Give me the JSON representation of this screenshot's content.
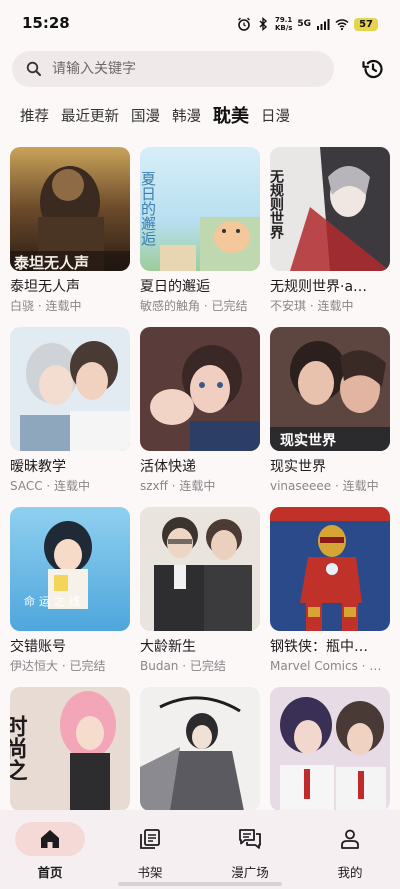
{
  "status_bar": {
    "time": "15:28",
    "net_speed_value": "79.1",
    "net_speed_unit": "KB/s",
    "network": "5G",
    "battery": "57"
  },
  "search": {
    "placeholder": "请输入关键字",
    "history_icon": "history-icon"
  },
  "tabs": [
    {
      "label": "推荐",
      "active": false
    },
    {
      "label": "最近更新",
      "active": false
    },
    {
      "label": "国漫",
      "active": false
    },
    {
      "label": "韩漫",
      "active": false
    },
    {
      "label": "耽美",
      "active": true
    },
    {
      "label": "日漫",
      "active": false
    }
  ],
  "comics": [
    {
      "title": "泰坦无人声",
      "subtitle": "白骁 · 连载中",
      "cover_text": "泰坦无人声"
    },
    {
      "title": "夏日的邂逅",
      "subtitle": "敏感的触角 · 已完结",
      "cover_text": "夏日的邂逅"
    },
    {
      "title": "无规则世界·a…",
      "subtitle": "不安琪 · 连载中",
      "cover_text": "无规则世界"
    },
    {
      "title": "暧昧教学",
      "subtitle": "SACC · 连载中",
      "cover_text": ""
    },
    {
      "title": "活体快递",
      "subtitle": "szxff · 连载中",
      "cover_text": ""
    },
    {
      "title": "现实世界",
      "subtitle": "vinaseeee · 连载中",
      "cover_text": "现实世界"
    },
    {
      "title": "交错账号",
      "subtitle": "伊达恒大 · 已完结",
      "cover_text": "命运之线"
    },
    {
      "title": "大龄新生",
      "subtitle": "Budan · 已完结",
      "cover_text": ""
    },
    {
      "title": "钢铁侠：瓶中…",
      "subtitle": "Marvel Comics · 已完结",
      "cover_text": ""
    },
    {
      "title": "",
      "subtitle": "",
      "cover_text": "时尚之"
    },
    {
      "title": "",
      "subtitle": "",
      "cover_text": ""
    },
    {
      "title": "",
      "subtitle": "",
      "cover_text": ""
    }
  ],
  "bottom_nav": [
    {
      "label": "首页",
      "icon": "home-icon",
      "active": true
    },
    {
      "label": "书架",
      "icon": "bookshelf-icon",
      "active": false
    },
    {
      "label": "漫广场",
      "icon": "chat-bubbles-icon",
      "active": false
    },
    {
      "label": "我的",
      "icon": "person-icon",
      "active": false
    }
  ],
  "colors": {
    "background": "#fdf8f8",
    "search_bg": "#efe9ea",
    "nav_active_pill": "#f5d9d6",
    "battery": "#e6d44c"
  }
}
